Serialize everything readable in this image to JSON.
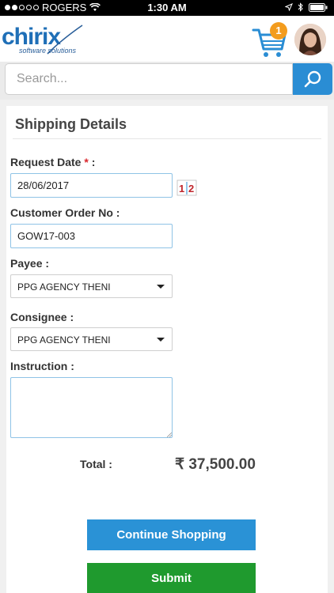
{
  "status_bar": {
    "carrier": "ROGERS",
    "time": "1:30 AM"
  },
  "header": {
    "logo_text": "chirix",
    "logo_tagline": "software solutions",
    "cart_count": "1"
  },
  "search": {
    "placeholder": "Search..."
  },
  "form": {
    "title": "Shipping Details",
    "request_date_label": "Request Date",
    "request_date_required": "*",
    "request_date_suffix": " :",
    "request_date_value": "28/06/2017",
    "calendar_icon_text": "1|2",
    "customer_order_label": "Customer Order No   :",
    "customer_order_value": "GOW17-003",
    "payee_label": "Payee   :",
    "payee_value": "PPG AGENCY THENI",
    "consignee_label": "Consignee   :",
    "consignee_value": "PPG AGENCY THENI",
    "instruction_label": "Instruction   :",
    "instruction_value": ""
  },
  "summary": {
    "total_label": "Total :",
    "total_value": "₹ 37,500.00"
  },
  "actions": {
    "continue_label": "Continue Shopping",
    "submit_label": "Submit"
  },
  "colors": {
    "brand_blue": "#2a8dd4",
    "submit_green": "#1f9a2e",
    "badge_orange": "#f39c1e",
    "required_red": "#d9262c"
  }
}
